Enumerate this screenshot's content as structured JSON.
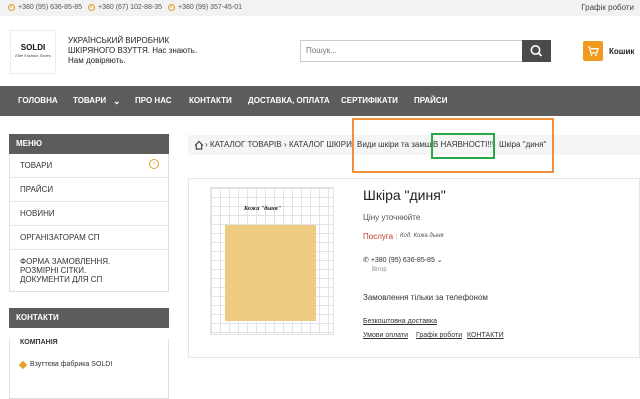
{
  "topbar": {
    "phones": [
      "+380 (95) 636-85-85",
      "+380 (67) 102-88-35",
      "+380 (99) 357-45-01"
    ],
    "schedule_label": "Графік роботи"
  },
  "header": {
    "logo_main": "SOLDI",
    "logo_sub": "Elite Fashion Shoes",
    "tagline": "УКРАЇНСЬКИЙ ВИРОБНИК ШКІРЯНОГО ВЗУТТЯ. Нас знають. Нам довіряють.",
    "search_placeholder": "Пошук...",
    "cart_label": "Кошик"
  },
  "nav": [
    "ГОЛОВНА",
    "ТОВАРИ",
    "ПРО НАС",
    "КОНТАКТИ",
    "ДОСТАВКА, ОПЛАТА",
    "СЕРТИФІКАТИ",
    "ПРАЙСИ"
  ],
  "sidebar": {
    "menu_title": "МЕНЮ",
    "items": [
      "ТОВАРИ",
      "ПРАЙСИ",
      "НОВИНИ",
      "ОРГАНІЗАТОРАМ СП",
      "ФОРМА ЗАМОВЛЕННЯ. РОЗМІРНІ СІТКИ. ДОКУМЕНТИ ДЛЯ СП"
    ],
    "contacts_title": "КОНТАКТИ",
    "company_label": "КОМПАНІЯ",
    "company_name": "Взуттєва фабрика SOLDI"
  },
  "breadcrumb": [
    "КАТАЛОГ ТОВАРІВ",
    "КАТАЛОГ ШКІРИ",
    "Види шкіри та замші",
    "В НАЯВНОСТІ!!!",
    "Шкіра \"диня\""
  ],
  "product": {
    "image_caption": "Кожа \"дыня\"",
    "swatch_color": "#edcc82",
    "title": "Шкіра \"диня\"",
    "price_text": "Ціну уточнюйте",
    "service_label": "Послуга",
    "code_text": "Код: Кожа дыня",
    "phone": "+380 (95) 636-85-85",
    "phone_sub": "Вiтор",
    "order_note": "Замовлення тільки за телефоном",
    "links": [
      "Безкоштовна доставка",
      "Умови оплати",
      "Графік роботи",
      "КОНТАКТИ"
    ]
  },
  "colors": {
    "accent": "#f29a1f",
    "nav_bg": "#5c5c5c",
    "highlight_orange": "#f0903a",
    "highlight_green": "#2aa84a"
  }
}
